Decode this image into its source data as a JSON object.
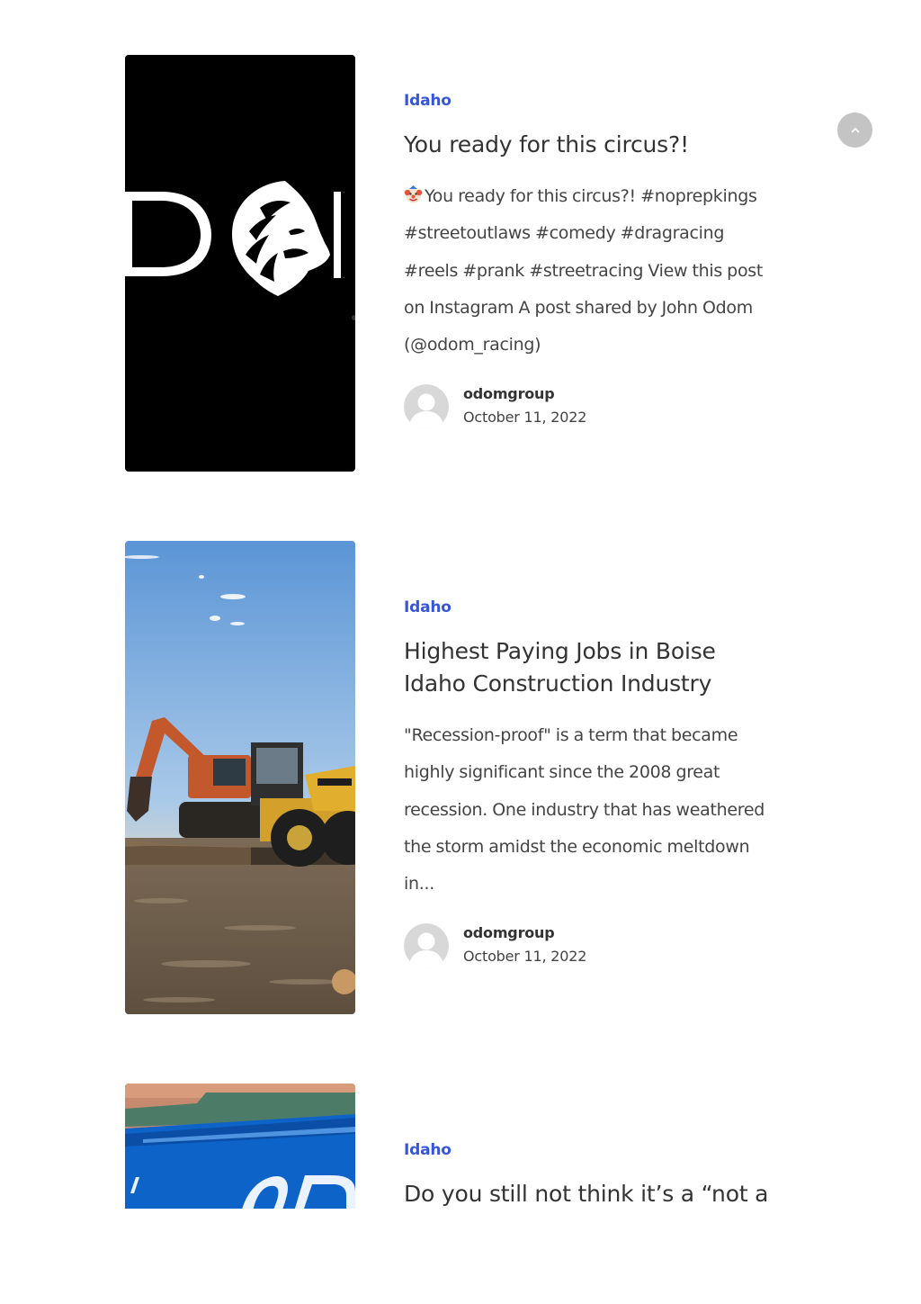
{
  "posts": [
    {
      "category": "Idaho",
      "title": "You ready for this circus?!",
      "excerpt": "You ready for this circus?! #noprepkings #streetoutlaws #comedy #dragracing #reels #prank #streetracing   View this post on Instagram A post shared by John Odom (@odom_racing)",
      "emoji": "clown-face-icon",
      "image": "odom-lion-logo",
      "author": "odomgroup",
      "date": "October 11, 2022"
    },
    {
      "category": "Idaho",
      "title": "Highest Paying Jobs in Boise Idaho Construction Industry",
      "excerpt": "\"Recession-proof\" is a term that became highly significant since the 2008 great recession. One industry that has weathered the storm amidst the economic meltdown in...",
      "image": "construction-excavators-photo",
      "author": "odomgroup",
      "date": "October 11, 2022"
    },
    {
      "category": "Idaho",
      "title": "Do you still not think it’s a “not a",
      "image": "odom-race-car-photo"
    }
  ],
  "scroll_top": {
    "icon": "chevron-up-icon"
  },
  "colors": {
    "category": "#3755d8",
    "text": "#333333",
    "scroll_button": "#c4c4c4"
  }
}
